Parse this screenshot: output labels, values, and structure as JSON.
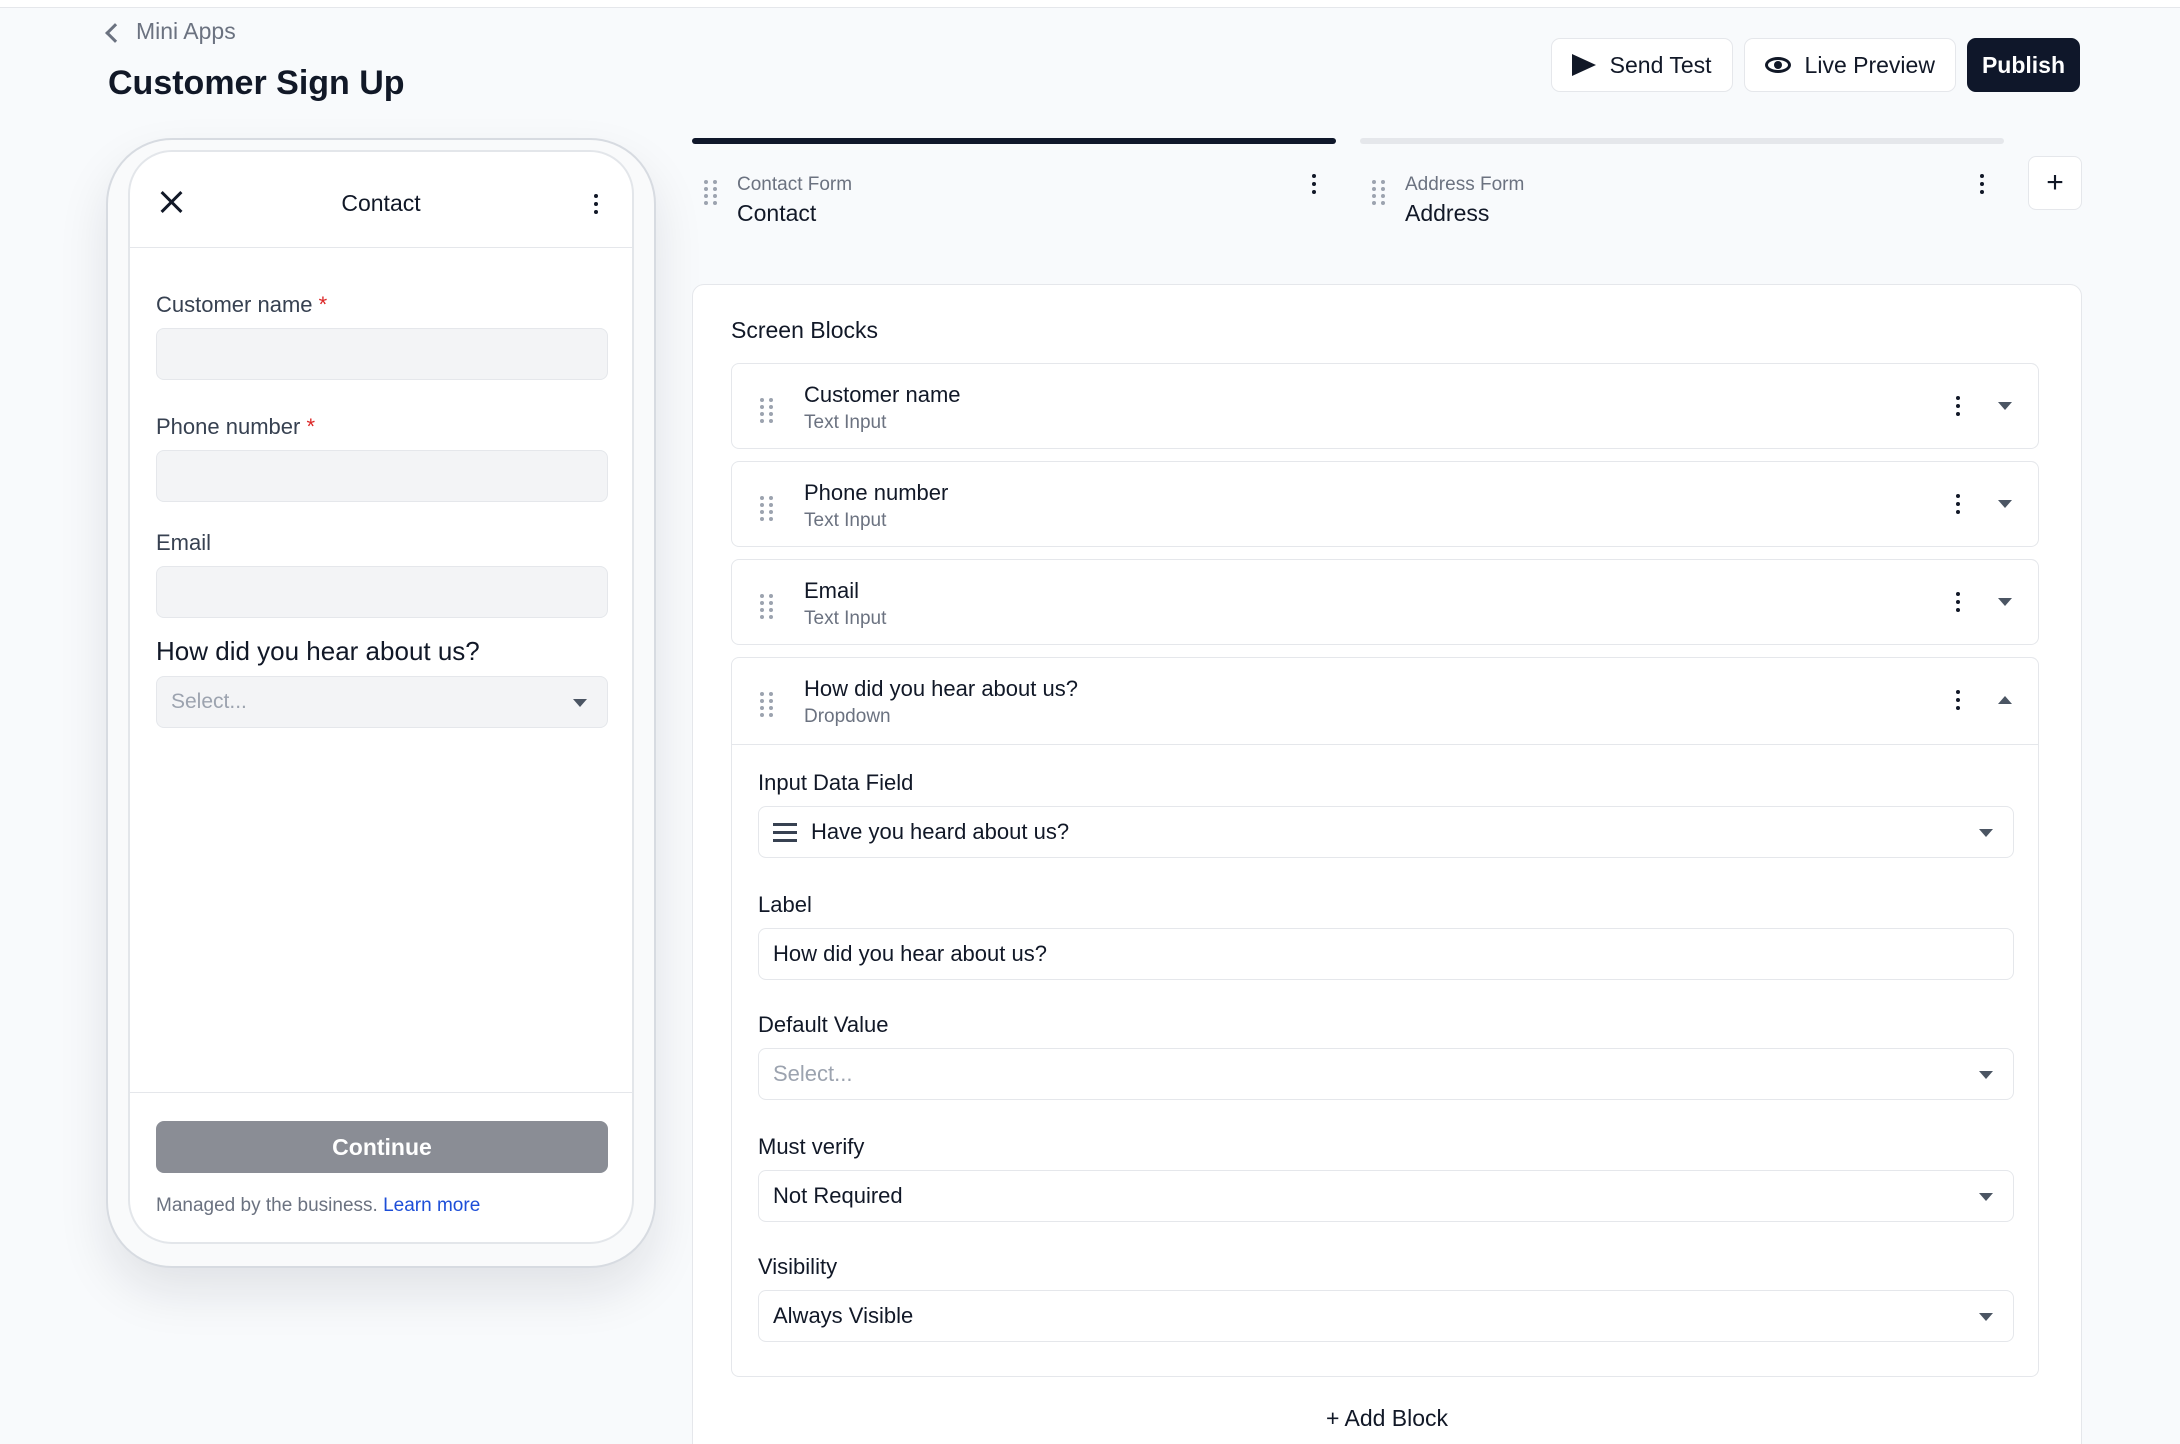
{
  "breadcrumb": {
    "label": "Mini Apps"
  },
  "page": {
    "title": "Customer Sign Up"
  },
  "actions": {
    "send_test": "Send Test",
    "live_preview": "Live Preview",
    "publish": "Publish"
  },
  "preview": {
    "title": "Contact",
    "fields": [
      {
        "label": "Customer name",
        "required": "*"
      },
      {
        "label": "Phone number",
        "required": "*"
      },
      {
        "label": "Email"
      }
    ],
    "question": "How did you hear about us?",
    "select_placeholder": "Select...",
    "continue": "Continue",
    "managed_text": "Managed by the business.",
    "learn_more": "Learn more"
  },
  "screens": [
    {
      "sub": "Contact Form",
      "name": "Contact",
      "active": true
    },
    {
      "sub": "Address Form",
      "name": "Address",
      "active": false
    }
  ],
  "add_screen": "+",
  "blocks_panel": {
    "title": "Screen Blocks",
    "blocks": [
      {
        "name": "Customer name",
        "type": "Text Input"
      },
      {
        "name": "Phone number",
        "type": "Text Input"
      },
      {
        "name": "Email",
        "type": "Text Input"
      },
      {
        "name": "How did you hear about us?",
        "type": "Dropdown"
      }
    ],
    "expanded": {
      "input_data_field_label": "Input Data Field",
      "input_data_field_value": "Have you heard about us?",
      "label_label": "Label",
      "label_value": "How did you hear about us?",
      "default_value_label": "Default Value",
      "default_value_placeholder": "Select...",
      "must_verify_label": "Must verify",
      "must_verify_value": "Not Required",
      "visibility_label": "Visibility",
      "visibility_value": "Always Visible"
    },
    "add_block": "+  Add Block"
  },
  "colors": {
    "primary_dark": "#0f172a",
    "required_red": "#dc2626",
    "link_blue": "#1d4ed8",
    "disabled_button": "#8a8d95"
  }
}
